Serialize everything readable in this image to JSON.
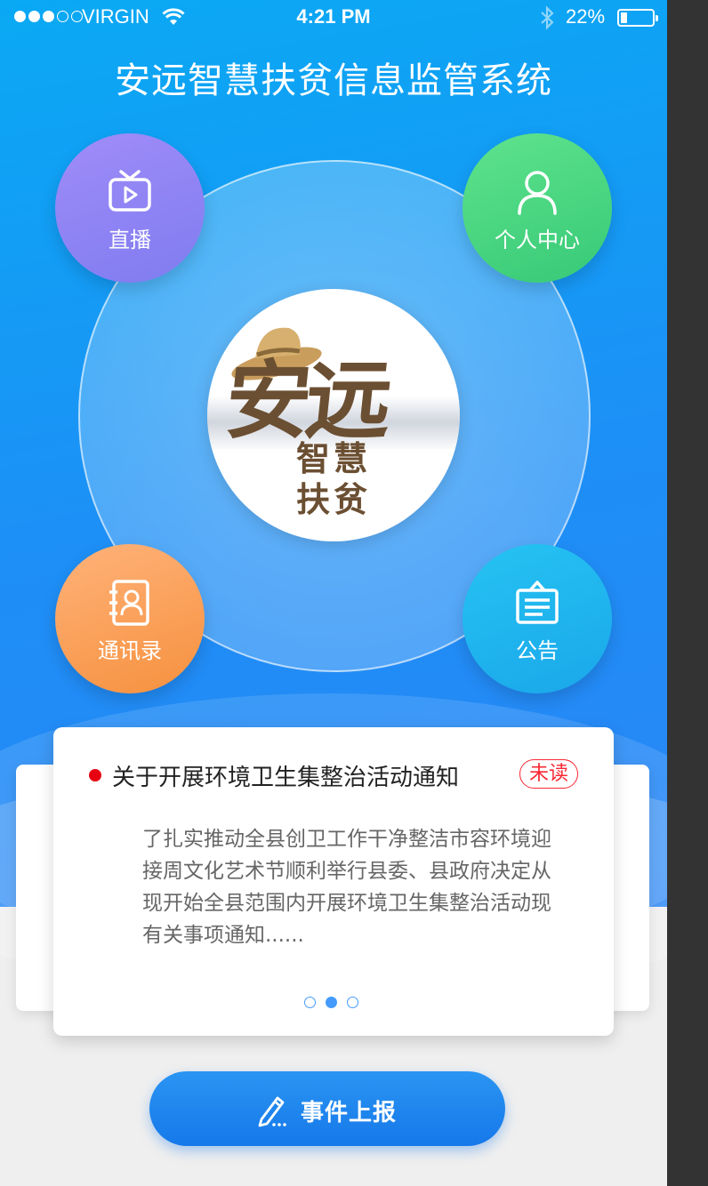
{
  "status_bar": {
    "carrier": "VIRGIN",
    "time": "4:21 PM",
    "battery_percent": "22%",
    "battery_level": 0.22,
    "signal_bars_filled": 3,
    "signal_bars_total": 5
  },
  "header": {
    "title": "安远智慧扶贫信息监管系统"
  },
  "logo": {
    "main": "安远",
    "sub_line1": "智慧",
    "sub_line2": "扶贫"
  },
  "features": {
    "live": {
      "label": "直播",
      "icon": "tv-play-icon"
    },
    "personal": {
      "label": "个人中心",
      "icon": "user-icon"
    },
    "contacts": {
      "label": "通讯录",
      "icon": "contact-book-icon"
    },
    "notice": {
      "label": "公告",
      "icon": "notice-board-icon"
    }
  },
  "notice_card": {
    "title": "关于开展环境卫生集整治活动通知",
    "badge": "未读",
    "body": "了扎实推动全县创卫工作干净整洁市容环境迎接周文化艺术节顺利举行县委、县政府决定从现开始全县范围内开展环境卫生集整治活动现有关事项通知......",
    "pager": {
      "total": 3,
      "active_index": 1
    }
  },
  "report_button": {
    "label": "事件上报",
    "icon": "pencil-edit-icon"
  },
  "colors": {
    "header_bg": "#00baf6",
    "title_text": "#ffffff",
    "card_title": "#222222",
    "unread_dot": "#e60012",
    "unread_badge": "#fa2834",
    "pager": "#449bfd",
    "notice_button": "#2194fc"
  }
}
